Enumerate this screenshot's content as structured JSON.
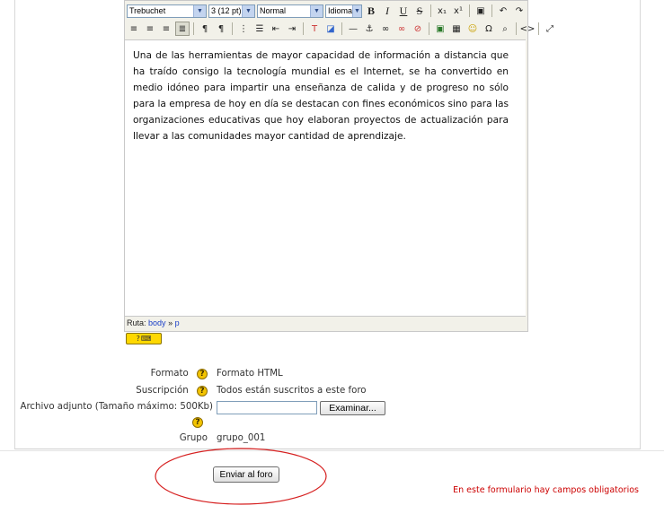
{
  "editor": {
    "toolbar": {
      "font_family": "Trebuchet",
      "font_size": "3 (12 pt)",
      "paragraph_format": "Normal",
      "language": "Idioma",
      "bold_label": "B",
      "italic_label": "I",
      "underline_label": "U",
      "strike_label": "S"
    },
    "content": "Una de las herramientas de mayor capacidad de información a distancia que ha traído consigo la tecnología mundial es el Internet, se ha convertido en medio idóneo para impartir una enseñanza de calida y de progreso no sólo para la empresa de hoy en día se destacan con fines económicos sino para las organizaciones educativas que hoy elaboran proyectos de actualización para llevar a las comunidades mayor cantidad de aprendizaje.",
    "path_label": "Ruta:",
    "path_body": "body",
    "path_sep": "»",
    "path_p": "p"
  },
  "form": {
    "format_label": "Formato",
    "format_value": "Formato HTML",
    "subscription_label": "Suscripción",
    "subscription_value": "Todos están suscritos a este foro",
    "attachment_label": "Archivo adjunto (Tamaño máximo: 500Kb)",
    "browse_label": "Examinar...",
    "group_label": "Grupo",
    "group_value": "grupo_001",
    "submit_label": "Enviar al foro",
    "required_note": "En este formulario hay campos obligatorios"
  },
  "icons": {
    "help": "question-mark-icon",
    "keyboard_help": "keyboard-help-icon"
  },
  "colors": {
    "required_note": "#cc0000",
    "link": "#1a3fc7",
    "help_icon": "#f3c400",
    "annotation_ellipse": "#d62020"
  }
}
